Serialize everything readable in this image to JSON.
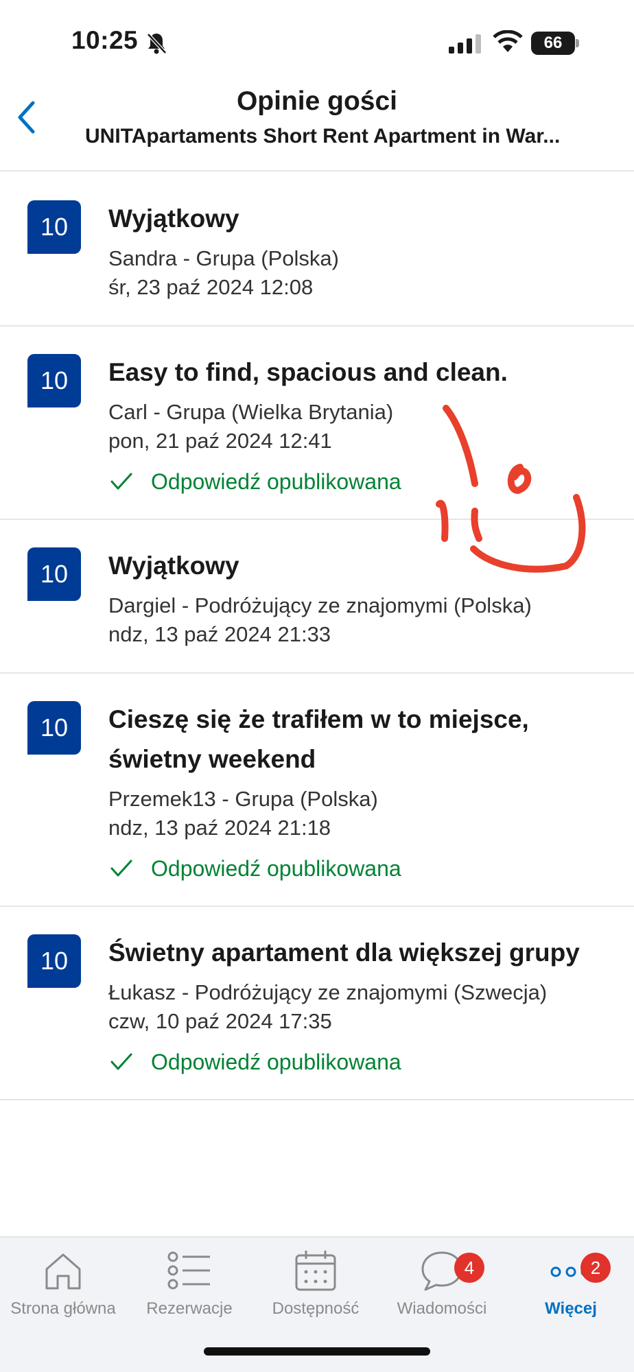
{
  "status_bar": {
    "time": "10:25",
    "battery": "66",
    "icons": [
      "bell-slash-icon",
      "signal-icon",
      "wifi-icon",
      "battery-icon"
    ]
  },
  "header": {
    "title": "Opinie gości",
    "subtitle": "UNITApartaments Short Rent Apartment in War...",
    "back_icon": "chevron-left-icon"
  },
  "reviews": [
    {
      "score": "10",
      "title": "Wyjątkowy",
      "author": "Sandra - Grupa (Polska)",
      "date": "śr, 23 paź 2024 12:08",
      "response": ""
    },
    {
      "score": "10",
      "title": "Easy to find, spacious and clean.",
      "author": "Carl - Grupa (Wielka Brytania)",
      "date": "pon, 21 paź 2024 12:41",
      "response": "Odpowiedź opublikowana"
    },
    {
      "score": "10",
      "title": "Wyjątkowy",
      "author": "Dargiel - Podróżujący ze znajomymi (Polska)",
      "date": "ndz, 13 paź 2024 21:33",
      "response": ""
    },
    {
      "score": "10",
      "title": "Cieszę się że trafiłem w to miejsce, świetny weekend",
      "author": "Przemek13 - Grupa (Polska)",
      "date": "ndz, 13 paź 2024 21:18",
      "response": "Odpowiedź opublikowana"
    },
    {
      "score": "10",
      "title": "Świetny apartament dla większej grupy",
      "author": "Łukasz - Podróżujący ze znajomymi (Szwecja)",
      "date": "czw, 10 paź 2024 17:35",
      "response": "Odpowiedź opublikowana"
    }
  ],
  "tabbar": {
    "tabs": [
      {
        "label": "Strona główna",
        "icon": "home-icon",
        "badge": ""
      },
      {
        "label": "Rezerwacje",
        "icon": "list-icon",
        "badge": ""
      },
      {
        "label": "Dostępność",
        "icon": "calendar-icon",
        "badge": ""
      },
      {
        "label": "Wiadomości",
        "icon": "chat-bubble-icon",
        "badge": "4"
      },
      {
        "label": "Więcej",
        "icon": "more-dots-icon",
        "badge": "2"
      }
    ],
    "active": "Więcej"
  },
  "colors": {
    "score_bg": "#003b95",
    "response_green": "#008234",
    "active_tab": "#0071c2",
    "badge_red": "#e1332b",
    "scribble_red": "#e8402c"
  }
}
